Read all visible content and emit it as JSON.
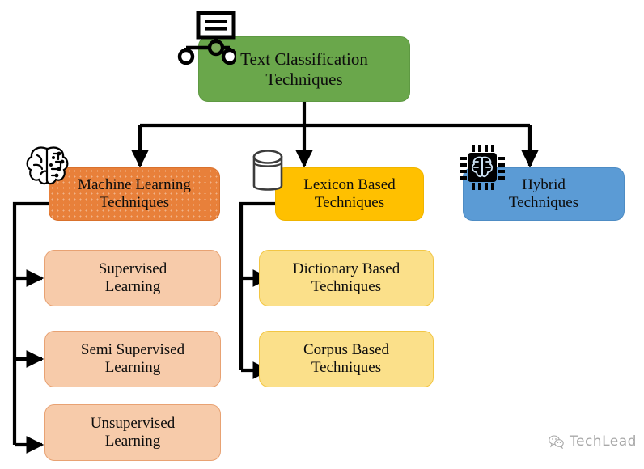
{
  "diagram": {
    "title": "Text Classification Techniques",
    "root": {
      "id": "root",
      "label": "Text Classification\nTechniques",
      "color": "#6AA74B",
      "icon": "sitemap-icon"
    },
    "branches": [
      {
        "id": "machine-learning",
        "label": "Machine Learning\nTechniques",
        "color": "#E8803A",
        "icon": "brain-ai-icon",
        "children": [
          {
            "id": "supervised-learning",
            "label": "Supervised\nLearning",
            "color": "#F7CBAA"
          },
          {
            "id": "semi-supervised-learning",
            "label": "Semi Supervised\nLearning",
            "color": "#F7CBAA"
          },
          {
            "id": "unsupervised-learning",
            "label": "Unsupervised\nLearning",
            "color": "#F7CBAA"
          }
        ]
      },
      {
        "id": "lexicon-based",
        "label": "Lexicon Based\nTechniques",
        "color": "#FFC000",
        "icon": "database-cylinder-icon",
        "children": [
          {
            "id": "dictionary-based",
            "label": "Dictionary Based\nTechniques",
            "color": "#FBE08A"
          },
          {
            "id": "corpus-based",
            "label": "Corpus Based\nTechniques",
            "color": "#FBE08A"
          }
        ]
      },
      {
        "id": "hybrid",
        "label": "Hybrid\nTechniques",
        "color": "#5B9BD5",
        "icon": "ai-chip-icon",
        "children": []
      }
    ]
  },
  "watermark": {
    "label": "TechLead",
    "icon": "wechat-icon",
    "color": "#9A9A9A"
  },
  "palette": {
    "background": "#FFFFFF",
    "connector": "#000000",
    "text": "#0D0D0D"
  }
}
